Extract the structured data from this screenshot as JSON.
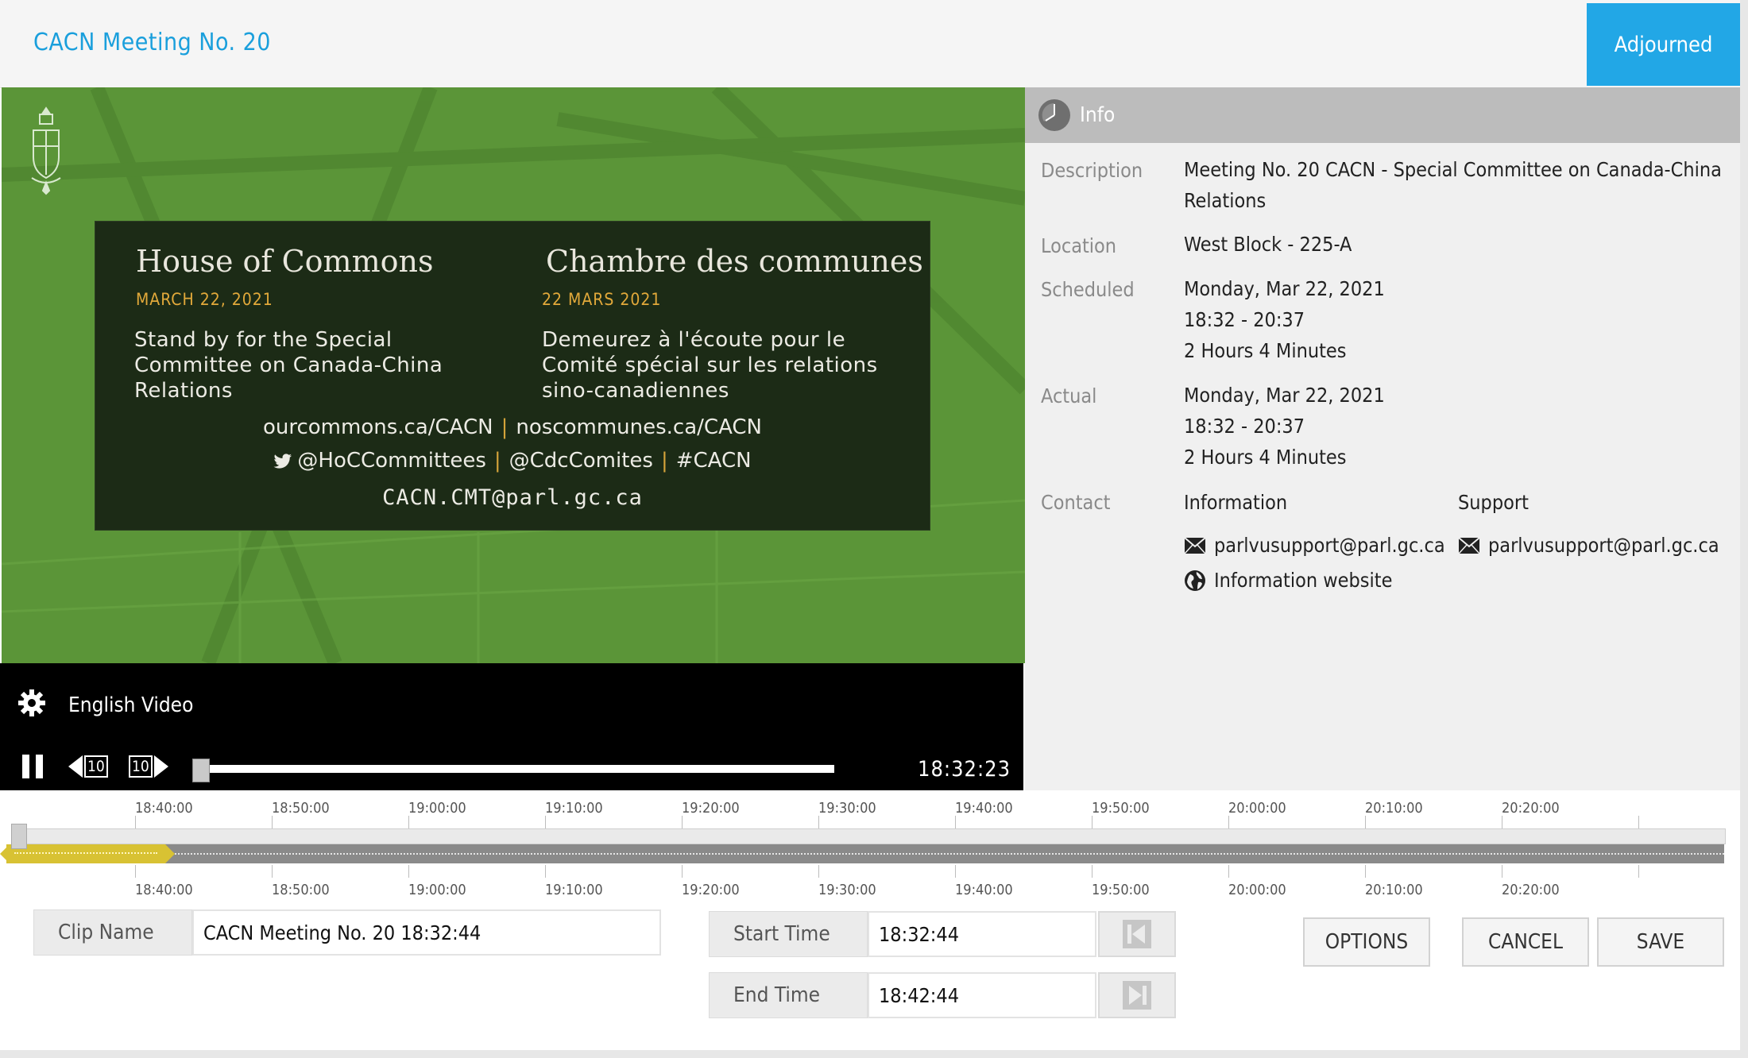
{
  "header": {
    "title": "CACN Meeting No. 20",
    "status": "Adjourned"
  },
  "video": {
    "card": {
      "en_title": "House of Commons",
      "fr_title": "Chambre des communes",
      "en_date": "MARCH 22, 2021",
      "fr_date": "22 MARS 2021",
      "en_msg": "Stand by for the Special Committee on Canada-China Relations",
      "fr_msg": "Demeurez à l'écoute pour le Comité spécial sur les relations sino-canadiennes",
      "url_en": "ourcommons.ca/CACN",
      "url_fr": "noscommunes.ca/CACN",
      "handle_en": "@HoCCommittees",
      "handle_fr": "@CdcComites",
      "hashtag": "#CACN",
      "email": "CACN.CMT@parl.gc.ca"
    },
    "language": "English Video",
    "skip_back": "10",
    "skip_forward": "10",
    "current_time": "18:32:23",
    "progress": 0.0
  },
  "info": {
    "heading": "Info",
    "description_label": "Description",
    "description": "Meeting No. 20 CACN - Special Committee on Canada-China Relations",
    "location_label": "Location",
    "location": "West Block - 225-A",
    "scheduled_label": "Scheduled",
    "scheduled": [
      "Monday, Mar 22, 2021",
      "18:32 - 20:37",
      "2 Hours 4 Minutes"
    ],
    "actual_label": "Actual",
    "actual": [
      "Monday, Mar 22, 2021",
      "18:32 - 20:37",
      "2 Hours 4 Minutes"
    ],
    "contact_label": "Contact",
    "information_heading": "Information",
    "support_heading": "Support",
    "information_email": "parlvusupport@parl.gc.ca",
    "support_email": "parlvusupport@parl.gc.ca",
    "information_website": "Information website"
  },
  "timeline": {
    "ticks": [
      "18:40:00",
      "18:50:00",
      "19:00:00",
      "19:10:00",
      "19:20:00",
      "19:30:00",
      "19:40:00",
      "19:50:00",
      "20:00:00",
      "20:10:00",
      "20:20:00"
    ]
  },
  "clip": {
    "name_label": "Clip Name",
    "name_value": "CACN Meeting No. 20 18:32:44",
    "start_label": "Start Time",
    "start_value": "18:32:44",
    "end_label": "End Time",
    "end_value": "18:42:44",
    "options": "OPTIONS",
    "cancel": "CANCEL",
    "save": "SAVE"
  },
  "colors": {
    "accent": "#22a7e6",
    "title": "#1a9fdc",
    "clip": "#d8c233",
    "video_green": "#5b9538"
  }
}
